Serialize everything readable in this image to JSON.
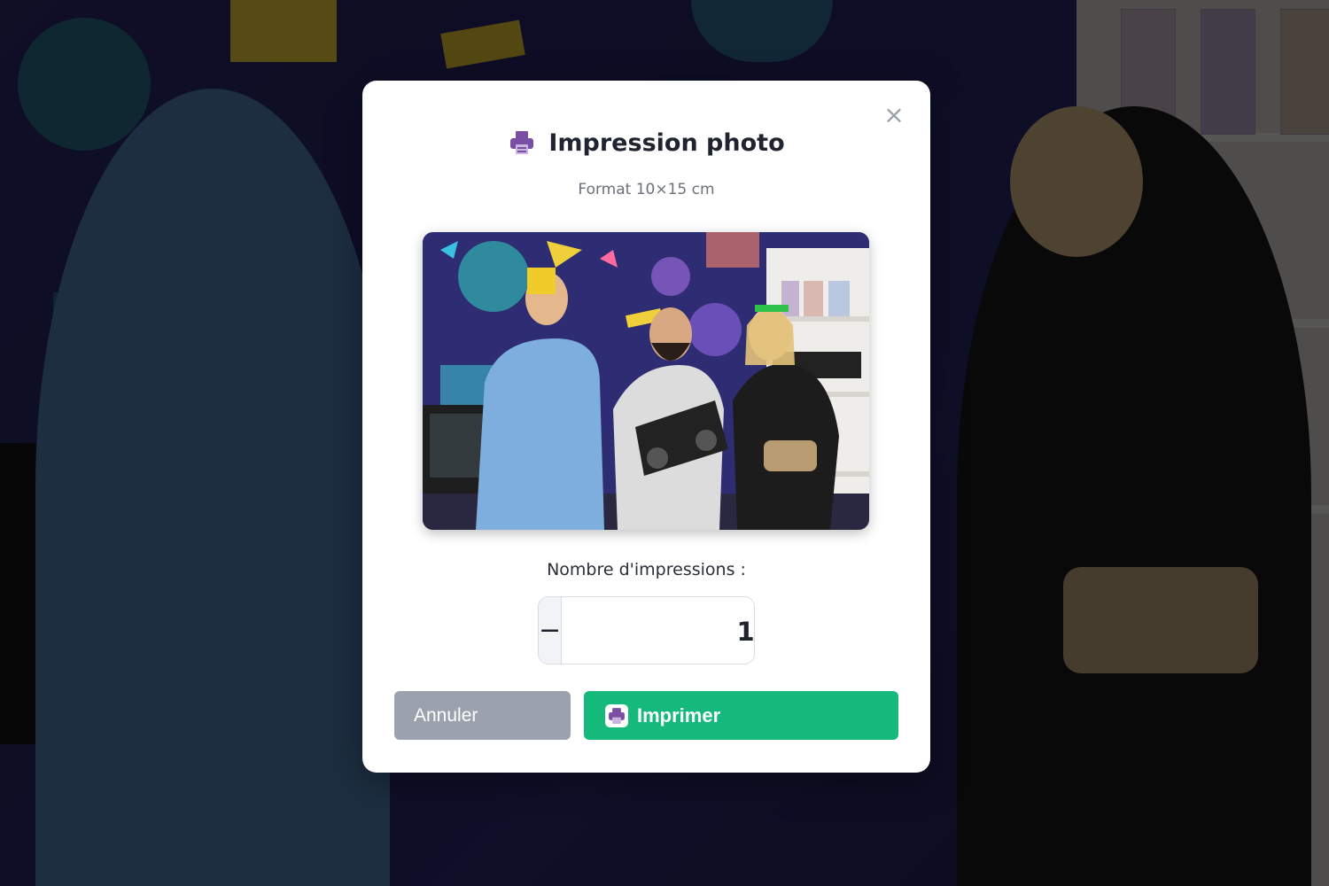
{
  "modal": {
    "title": "Impression photo",
    "subtitle": "Format 10×15 cm",
    "close_symbol": "×",
    "title_icon": "printer-icon",
    "count_label": "Nombre d'impressions :",
    "count_value": "1",
    "decrement_symbol": "−",
    "increment_symbol": "+",
    "cancel_label": "Annuler",
    "print_label": "Imprimer",
    "print_icon": "printer-icon"
  },
  "colors": {
    "print_button": "#16b97c",
    "cancel_button": "#9ca2ad",
    "icon_accent": "#7a4ea3"
  }
}
